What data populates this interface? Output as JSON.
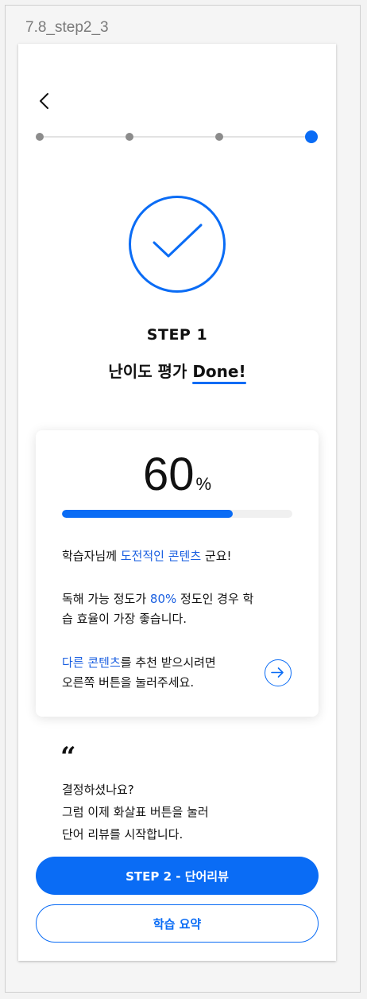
{
  "frame": {
    "label": "7.8_step2_3"
  },
  "header": {
    "back_icon": "chevron-left-icon"
  },
  "stepper": {
    "total_steps": 4,
    "current_step": 4
  },
  "completion": {
    "icon": "check-circle-icon",
    "step_label": "STEP 1",
    "title_prefix": "난이도 평가 ",
    "title_highlight": "Done!"
  },
  "result_card": {
    "percent_value": "60",
    "percent_unit": "%",
    "progress_fraction": 0.74,
    "line1_prefix": "학습자님께 ",
    "line1_highlight": "도전적인 콘텐츠",
    "line1_suffix": " 군요!",
    "line2_prefix": "독해 가능 정도가 ",
    "line2_highlight": "80%",
    "line2_suffix": " 정도인 경우 학",
    "line3": "습 효율이 가장 좋습니다.",
    "line4_highlight": "다른 콘텐츠",
    "line4_suffix": "를 추천 받으시려면",
    "line5": "오른쪽 버튼을 눌러주세요.",
    "arrow_icon": "arrow-right-circle-icon"
  },
  "quote": {
    "mark": "“",
    "line1": "결정하셨나요?",
    "line2": "그럼 이제 화살표 버튼을 눌러",
    "line3": "단어 리뷰를 시작합니다."
  },
  "buttons": {
    "primary_label": "STEP 2 - 단어리뷰",
    "secondary_label": "학습 요약"
  },
  "colors": {
    "accent": "#0a6cf5",
    "highlight_text": "#1a5fe0",
    "inactive_dot": "#8c8c8c"
  }
}
